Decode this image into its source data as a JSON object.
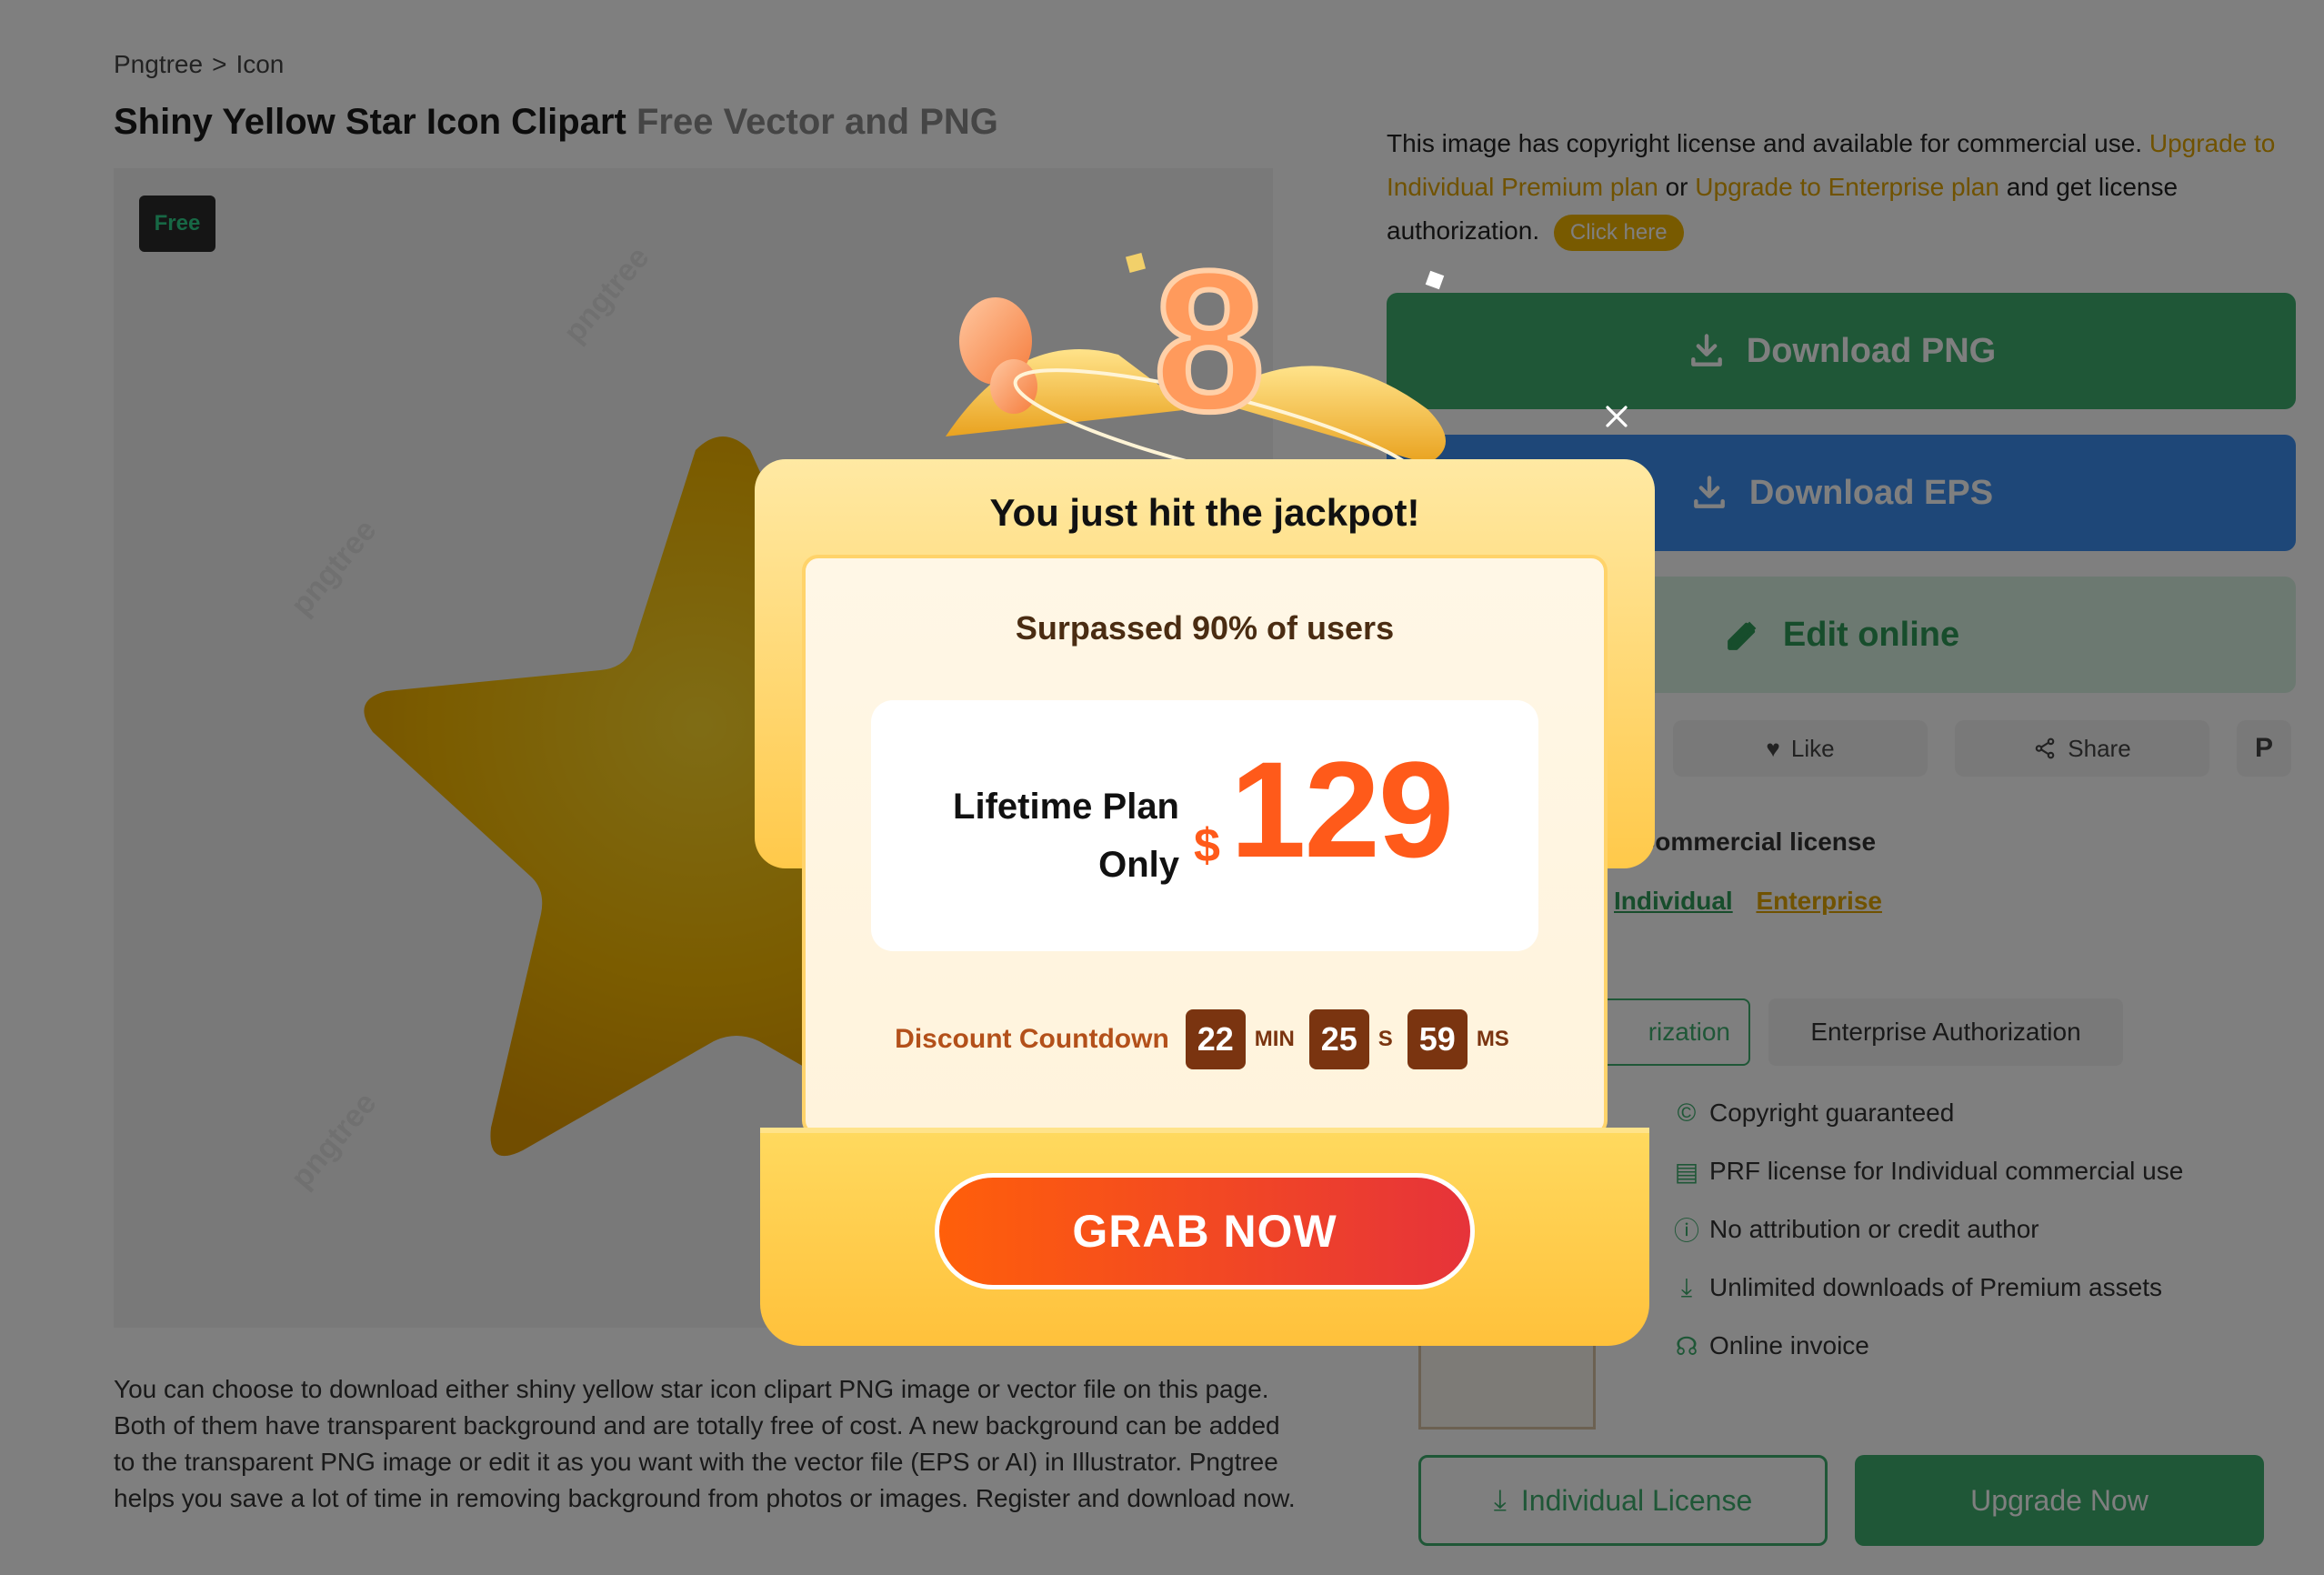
{
  "breadcrumb": {
    "home": "Pngtree",
    "separator": ">",
    "current": "Icon"
  },
  "title": {
    "main": "Shiny Yellow Star Icon Clipart",
    "suffix": "Free Vector and PNG"
  },
  "preview": {
    "badge": "Free",
    "watermark": "pngtree"
  },
  "description": "You can choose to download either shiny yellow star icon clipart PNG image or vector file on this page. Both of them have transparent background and are totally free of cost. A new background can be added to the transparent PNG image or edit it as you want with the vector file (EPS or AI) in Illustrator. Pngtree helps you save a lot of time in removing background from photos or images. Register and download now.",
  "license_notice": {
    "text_before": "This image has copyright license and available for commercial use.",
    "link_individual": "Upgrade to Individual Premium plan",
    "or": "or",
    "link_enterprise": "Upgrade to Enterprise plan",
    "text_after": "and get license authorization.",
    "click_here": "Click here"
  },
  "buttons": {
    "download_png": "Download PNG",
    "download_eps": "Download EPS",
    "edit_online": "Edit online",
    "like": "Like",
    "share": "Share"
  },
  "license": {
    "commercial_label": "Commercial license",
    "tab_individual": "Individual",
    "tab_enterprise": "Enterprise",
    "auth_individual": "rization",
    "auth_enterprise": "Enterprise Authorization",
    "features": [
      "Copyright guaranteed",
      "PRF license for Individual commercial use",
      "No attribution or credit author",
      "Unlimited downloads of Premium assets",
      "Online invoice"
    ],
    "individual_license_btn": "Individual License",
    "upgrade_now_btn": "Upgrade Now"
  },
  "modal": {
    "badge_number": "8",
    "headline": "You just hit the jackpot!",
    "surpassed": "Surpassed 90% of users",
    "plan_line1": "Lifetime Plan",
    "plan_line2": "Only",
    "currency": "$",
    "price": "129",
    "countdown_label": "Discount Countdown",
    "countdown": {
      "min": "22",
      "sec": "25",
      "ms": "59"
    },
    "units": {
      "min": "MIN",
      "sec": "S",
      "ms": "MS"
    },
    "cta": "GRAB NOW"
  },
  "colors": {
    "green": "#3fae6f",
    "blue": "#3d8ef0",
    "gold": "#e0a400",
    "orange": "#ff5a1a"
  }
}
